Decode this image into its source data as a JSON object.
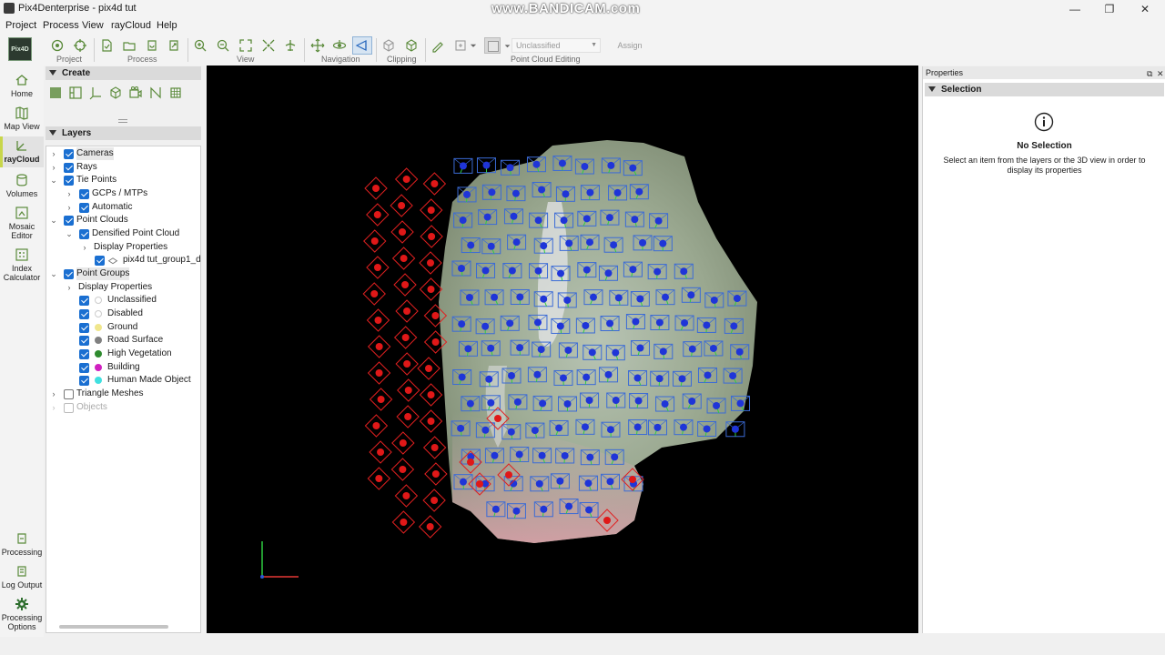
{
  "window": {
    "title": "Pix4Denterprise - pix4d tut",
    "watermark": "www.BANDICAM.com",
    "minimize": "—",
    "maximize": "❐",
    "close": "✕"
  },
  "menu": [
    "Project",
    "Process",
    "View",
    "rayCloud",
    "Help"
  ],
  "toolbar": {
    "groups": {
      "project": "Project",
      "process": "Process",
      "view": "View",
      "navigation": "Navigation",
      "clipping": "Clipping",
      "editing": "Point Cloud Editing"
    },
    "class_select": "Unclassified",
    "assign": "Assign",
    "logo": "Pix4D"
  },
  "nav": {
    "home": "Home",
    "map_view": "Map View",
    "raycloud": "rayCloud",
    "volumes": "Volumes",
    "mosaic_editor_1": "Mosaic",
    "mosaic_editor_2": "Editor",
    "index_calc_1": "Index",
    "index_calc_2": "Calculator",
    "processing": "Processing",
    "log_output": "Log Output",
    "processing_options_1": "Processing",
    "processing_options_2": "Options"
  },
  "panels": {
    "create": "Create",
    "layers": "Layers"
  },
  "layers": {
    "cameras": "Cameras",
    "rays": "Rays",
    "tie_points": "Tie Points",
    "gcps": "GCPs / MTPs",
    "automatic": "Automatic",
    "point_clouds": "Point Clouds",
    "densified": "Densified Point Cloud",
    "display_props_pc": "Display Properties",
    "group1": "pix4d tut_group1_d",
    "point_groups": "Point Groups",
    "display_props_pg": "Display Properties",
    "unclassified": "Unclassified",
    "disabled": "Disabled",
    "ground": "Ground",
    "road_surface": "Road Surface",
    "high_vegetation": "High Vegetation",
    "building": "Building",
    "human_made": "Human Made Object",
    "triangle_meshes": "Triangle Meshes",
    "objects": "Objects"
  },
  "class_colors": {
    "unclassified": "#ffffff",
    "disabled": "#ffffff",
    "ground": "#f0e68c",
    "road_surface": "#808080",
    "high_vegetation": "#2e8b2e",
    "building": "#d020c0",
    "human_made": "#40e0e0"
  },
  "properties": {
    "title": "Properties",
    "float": "⧉",
    "close": "✕",
    "selection": "Selection",
    "no_selection": "No Selection",
    "description": "Select an item from the layers or the 3D view in order to display its properties"
  }
}
